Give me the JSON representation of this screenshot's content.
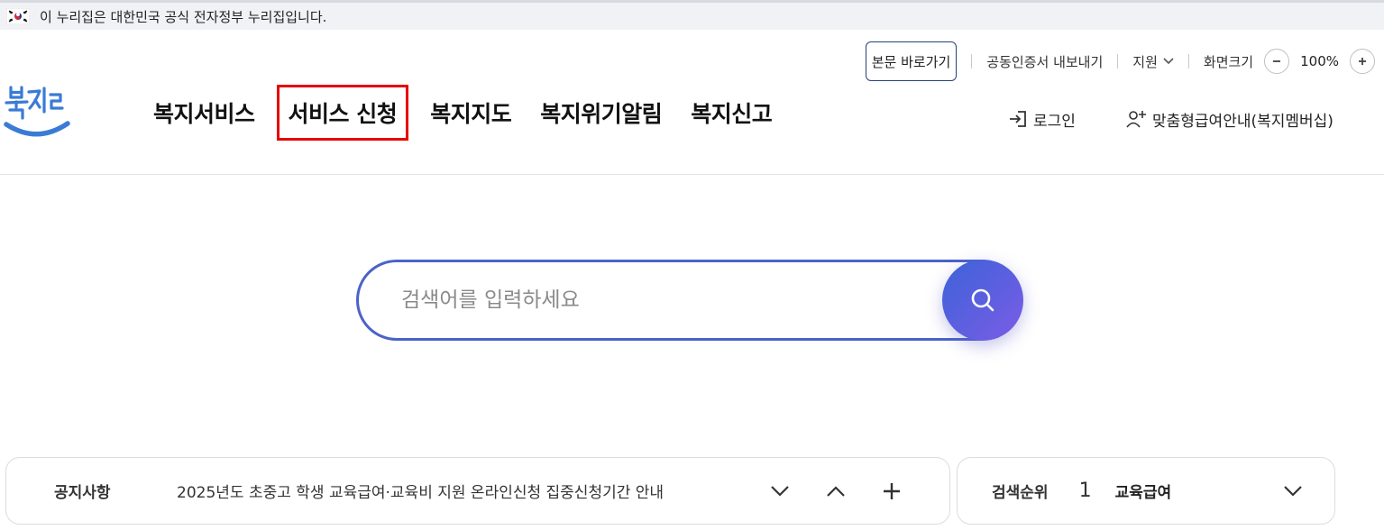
{
  "gov_banner": {
    "text": "이 누리집은 대한민국 공식 전자정부 누리집입니다."
  },
  "utility": {
    "skip_to_content": "본문 바로가기",
    "cert_export": "공동인증서 내보내기",
    "support": "지원",
    "zoom_label": "화면크기",
    "zoom_value": "100%"
  },
  "logo": {
    "text": "복지로",
    "color": "#3a7bd5"
  },
  "gnb": {
    "items": [
      {
        "label": "복지서비스"
      },
      {
        "label": "서비스 신청"
      },
      {
        "label": "복지지도"
      },
      {
        "label": "복지위기알림"
      },
      {
        "label": "복지신고"
      }
    ]
  },
  "account": {
    "login": "로그인",
    "membership": "맞춤형급여안내(복지멤버십)"
  },
  "search": {
    "placeholder": "검색어를 입력하세요",
    "value": ""
  },
  "notice": {
    "label": "공지사항",
    "text": "2025년도 초중고 학생 교육급여·교육비 지원 온라인신청 집중신청기간 안내"
  },
  "ranking": {
    "label": "검색순위",
    "rank": "1",
    "term": "교육급여"
  },
  "colors": {
    "highlight": "#e60000",
    "search_border": "#4b63c8",
    "search_button_start": "#3c63d8",
    "search_button_end": "#7b5ce6"
  }
}
